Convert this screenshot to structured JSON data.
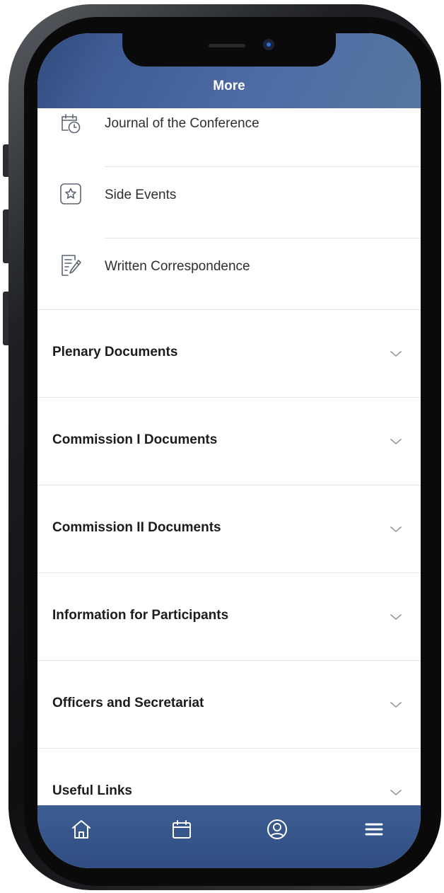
{
  "header": {
    "title": "More"
  },
  "menu_items": [
    {
      "label": "Journal of the Conference",
      "icon": "calendar-clock-icon"
    },
    {
      "label": "Side Events",
      "icon": "star-box-icon"
    },
    {
      "label": "Written Correspondence",
      "icon": "document-pen-icon"
    }
  ],
  "sections": [
    {
      "label": "Plenary Documents",
      "icon": "chevron-down-icon"
    },
    {
      "label": "Commission I Documents",
      "icon": "chevron-down-icon"
    },
    {
      "label": "Commission II Documents",
      "icon": "chevron-down-icon"
    },
    {
      "label": "Information for Participants",
      "icon": "chevron-down-icon"
    },
    {
      "label": "Officers and Secretariat",
      "icon": "chevron-down-icon"
    },
    {
      "label": "Useful Links",
      "icon": "chevron-down-icon"
    }
  ],
  "tabbar": {
    "items": [
      {
        "icon": "home-icon"
      },
      {
        "icon": "calendar-icon"
      },
      {
        "icon": "profile-icon"
      },
      {
        "icon": "menu-icon"
      }
    ]
  },
  "colors": {
    "header": "#3f5d94",
    "tabbar": "#2f4d82",
    "icon_stroke": "#5d6573",
    "chevron": "#9a9ea6",
    "separator": "#e4e4e6"
  }
}
